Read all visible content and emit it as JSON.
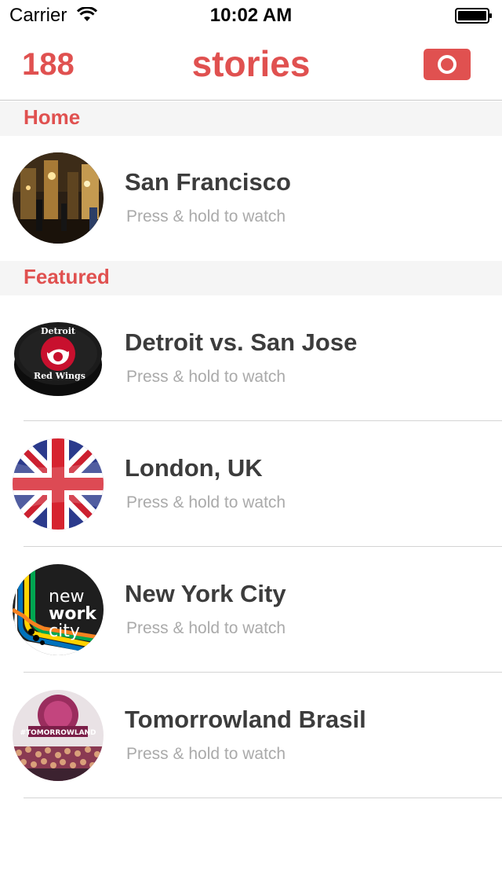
{
  "status_bar": {
    "carrier": "Carrier",
    "time": "10:02 AM"
  },
  "nav": {
    "count": "188",
    "title": "stories",
    "camera_icon": "camera-icon",
    "accent_color": "#e05150"
  },
  "sections": [
    {
      "title": "Home",
      "items": [
        {
          "title": "San Francisco",
          "subtitle": "Press & hold to watch",
          "thumb": "street-night-photo"
        }
      ]
    },
    {
      "title": "Featured",
      "items": [
        {
          "title": "Detroit vs. San Jose",
          "subtitle": "Press & hold to watch",
          "thumb": "hockey-puck-red-wings"
        },
        {
          "title": "London, UK",
          "subtitle": "Press & hold to watch",
          "thumb": "union-jack-flag"
        },
        {
          "title": "New York City",
          "subtitle": "Press & hold to watch",
          "thumb": "new-work-city-logo"
        },
        {
          "title": "Tomorrowland Brasil",
          "subtitle": "Press & hold to watch",
          "thumb": "festival-crowd-photo"
        }
      ]
    }
  ],
  "thumb_text": {
    "detroit_top": "Detroit",
    "detroit_bottom": "Red Wings",
    "nyc_line1": "new",
    "nyc_line2": "work",
    "nyc_line3": "city",
    "tomorrowland_banner": "#TOMORROWLAND"
  }
}
